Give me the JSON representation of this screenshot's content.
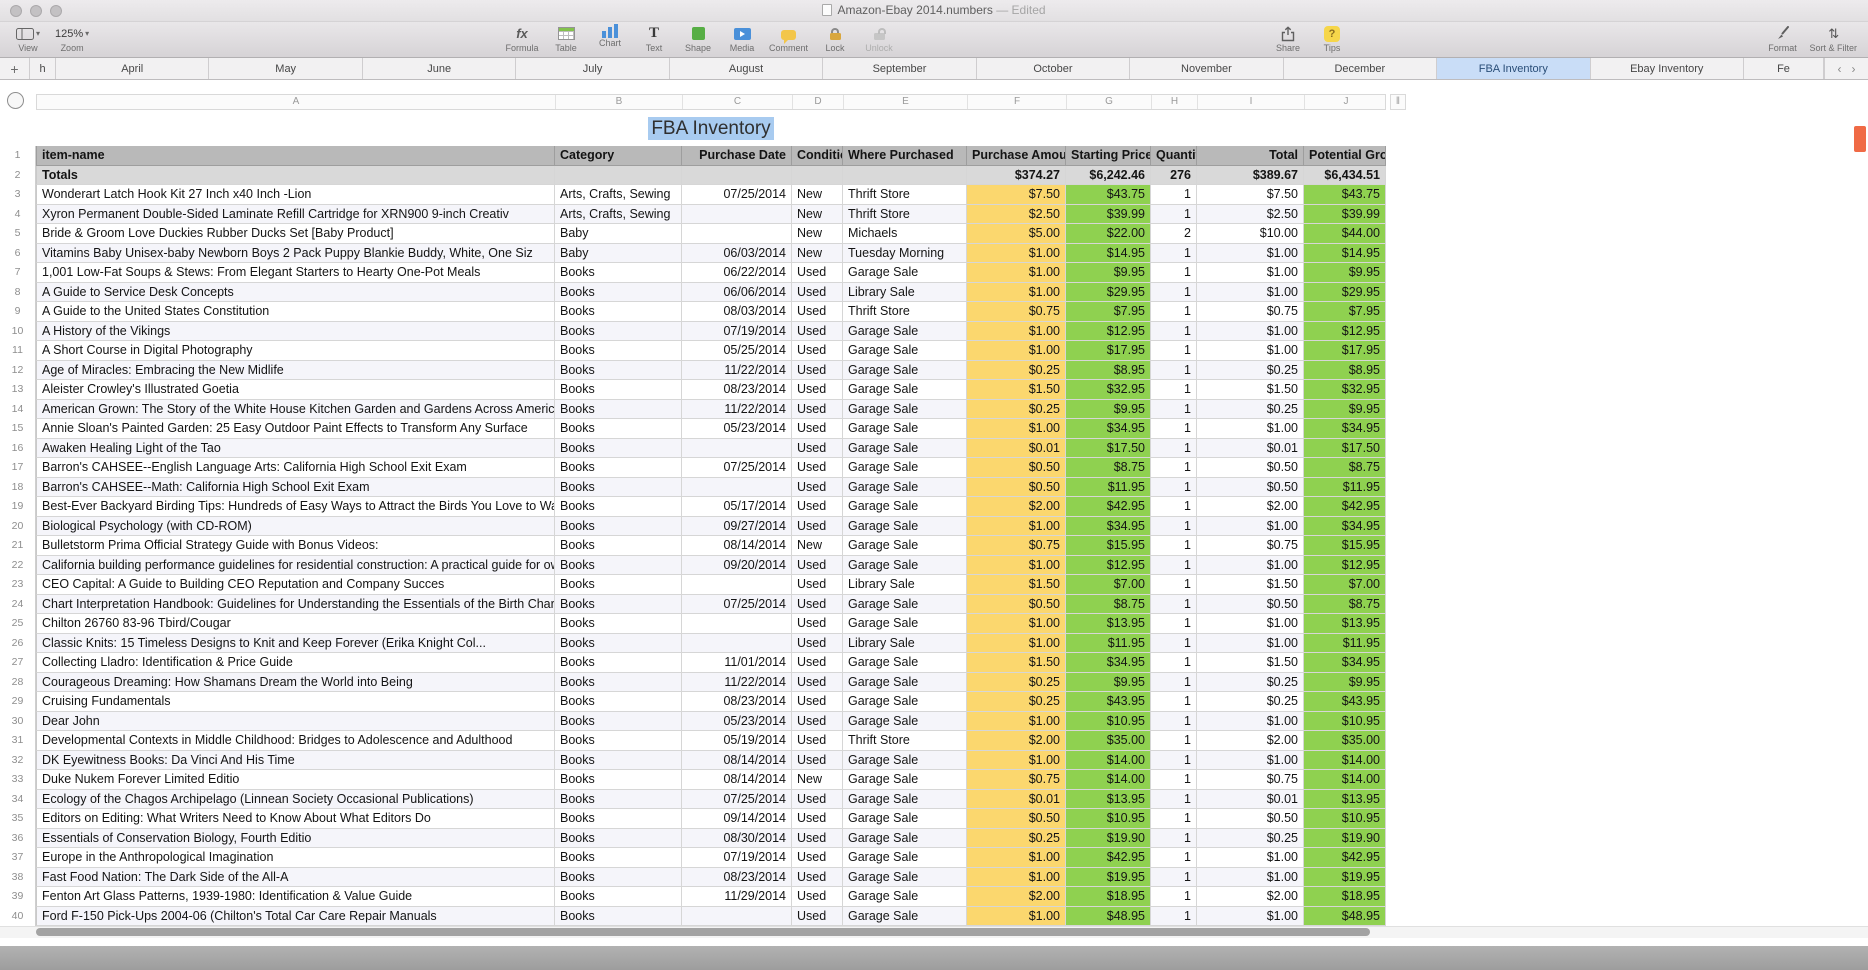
{
  "window": {
    "title": "Amazon-Ebay 2014.numbers",
    "edited_suffix": "— Edited"
  },
  "toolbar": {
    "view": {
      "label": "View"
    },
    "zoom": {
      "label": "Zoom",
      "value": "125%",
      "chevron": "▾"
    },
    "formula": {
      "label": "Formula",
      "glyph": "fx"
    },
    "table": {
      "label": "Table"
    },
    "chart": {
      "label": "Chart"
    },
    "text": {
      "label": "Text",
      "glyph": "T"
    },
    "shape": {
      "label": "Shape"
    },
    "media": {
      "label": "Media"
    },
    "comment": {
      "label": "Comment"
    },
    "lock": {
      "label": "Lock"
    },
    "unlock": {
      "label": "Unlock"
    },
    "share": {
      "label": "Share"
    },
    "tips": {
      "label": "Tips",
      "glyph": "?"
    },
    "format": {
      "label": "Format"
    },
    "sort_filter": {
      "label": "Sort & Filter",
      "glyph": "⇅"
    }
  },
  "tabbar": {
    "add_button": "+",
    "prev_arrow": "‹",
    "next_arrow": "›",
    "active": "FBA Inventory",
    "tabs": [
      {
        "label": "h",
        "cut": "left"
      },
      {
        "label": "April"
      },
      {
        "label": "May"
      },
      {
        "label": "June"
      },
      {
        "label": "July"
      },
      {
        "label": "August"
      },
      {
        "label": "September"
      },
      {
        "label": "October"
      },
      {
        "label": "November"
      },
      {
        "label": "December"
      },
      {
        "label": "FBA Inventory",
        "active": true
      },
      {
        "label": "Ebay Inventory"
      },
      {
        "label": "Fe",
        "cut": "right"
      }
    ]
  },
  "grid": {
    "column_letters": [
      "A",
      "B",
      "C",
      "D",
      "E",
      "F",
      "G",
      "H",
      "I",
      "J"
    ],
    "add_column_glyph": "‖"
  },
  "colors": {
    "amount_column": "#FBD76E",
    "price_columns": "#8FD150",
    "header_row": "#B9B9B9",
    "active_tab": "#C9DDF7",
    "title_selection": "#A8CBF0",
    "scroll_marker": "#F06A45"
  },
  "sheet": {
    "title": "FBA Inventory",
    "headers": [
      "item-name",
      "Category",
      "Purchase Date",
      "Condition",
      "Where Purchased",
      "Purchase Amount",
      "Starting Price",
      "Quantity",
      "Total",
      "Potential Gross"
    ],
    "totals": {
      "num": "2",
      "label": "Totals",
      "amount": "$374.27",
      "price": "$6,242.46",
      "qty": "276",
      "total": "$389.67",
      "gross": "$6,434.51"
    },
    "rows": [
      {
        "num": 3,
        "name": "Wonderart Latch Hook Kit 27 Inch x40 Inch -Lion",
        "category": "Arts, Crafts, Sewing",
        "date": "07/25/2014",
        "condition": "New",
        "where": "Thrift Store",
        "amount": "$7.50",
        "price": "$43.75",
        "qty": "1",
        "total": "$7.50",
        "gross": "$43.75"
      },
      {
        "num": 4,
        "name": "Xyron Permanent Double-Sided Laminate Refill Cartridge for XRN900 9-inch Creativ",
        "category": "Arts, Crafts, Sewing",
        "date": "",
        "condition": "New",
        "where": "Thrift Store",
        "amount": "$2.50",
        "price": "$39.99",
        "qty": "1",
        "total": "$2.50",
        "gross": "$39.99"
      },
      {
        "num": 5,
        "name": "Bride & Groom Love Duckies Rubber Ducks Set [Baby Product]",
        "category": "Baby",
        "date": "",
        "condition": "New",
        "where": "Michaels",
        "amount": "$5.00",
        "price": "$22.00",
        "qty": "2",
        "total": "$10.00",
        "gross": "$44.00"
      },
      {
        "num": 6,
        "name": "Vitamins Baby Unisex-baby Newborn Boys 2 Pack Puppy Blankie Buddy, White, One Siz",
        "category": "Baby",
        "date": "06/03/2014",
        "condition": "New",
        "where": "Tuesday Morning",
        "amount": "$1.00",
        "price": "$14.95",
        "qty": "1",
        "total": "$1.00",
        "gross": "$14.95"
      },
      {
        "num": 7,
        "name": "1,001 Low-Fat Soups & Stews: From Elegant Starters to Hearty One-Pot Meals",
        "category": "Books",
        "date": "06/22/2014",
        "condition": "Used",
        "where": "Garage Sale",
        "amount": "$1.00",
        "price": "$9.95",
        "qty": "1",
        "total": "$1.00",
        "gross": "$9.95"
      },
      {
        "num": 8,
        "name": "A Guide to Service Desk Concepts",
        "category": "Books",
        "date": "06/06/2014",
        "condition": "Used",
        "where": "Library Sale",
        "amount": "$1.00",
        "price": "$29.95",
        "qty": "1",
        "total": "$1.00",
        "gross": "$29.95"
      },
      {
        "num": 9,
        "name": "A Guide to the United States Constitution",
        "category": "Books",
        "date": "08/03/2014",
        "condition": "Used",
        "where": "Thrift Store",
        "amount": "$0.75",
        "price": "$7.95",
        "qty": "1",
        "total": "$0.75",
        "gross": "$7.95"
      },
      {
        "num": 10,
        "name": "A History of the Vikings",
        "category": "Books",
        "date": "07/19/2014",
        "condition": "Used",
        "where": "Garage Sale",
        "amount": "$1.00",
        "price": "$12.95",
        "qty": "1",
        "total": "$1.00",
        "gross": "$12.95"
      },
      {
        "num": 11,
        "name": "A Short Course in Digital Photography",
        "category": "Books",
        "date": "05/25/2014",
        "condition": "Used",
        "where": "Garage Sale",
        "amount": "$1.00",
        "price": "$17.95",
        "qty": "1",
        "total": "$1.00",
        "gross": "$17.95"
      },
      {
        "num": 12,
        "name": "Age of Miracles: Embracing the New Midlife",
        "category": "Books",
        "date": "11/22/2014",
        "condition": "Used",
        "where": "Garage Sale",
        "amount": "$0.25",
        "price": "$8.95",
        "qty": "1",
        "total": "$0.25",
        "gross": "$8.95"
      },
      {
        "num": 13,
        "name": "Aleister Crowley's Illustrated Goetia",
        "category": "Books",
        "date": "08/23/2014",
        "condition": "Used",
        "where": "Garage Sale",
        "amount": "$1.50",
        "price": "$32.95",
        "qty": "1",
        "total": "$1.50",
        "gross": "$32.95"
      },
      {
        "num": 14,
        "name": "American Grown: The Story of the White House Kitchen Garden and Gardens Across America",
        "category": "Books",
        "date": "11/22/2014",
        "condition": "Used",
        "where": "Garage Sale",
        "amount": "$0.25",
        "price": "$9.95",
        "qty": "1",
        "total": "$0.25",
        "gross": "$9.95"
      },
      {
        "num": 15,
        "name": "Annie Sloan's Painted Garden: 25 Easy Outdoor Paint Effects to Transform Any Surface",
        "category": "Books",
        "date": "05/23/2014",
        "condition": "Used",
        "where": "Garage Sale",
        "amount": "$1.00",
        "price": "$34.95",
        "qty": "1",
        "total": "$1.00",
        "gross": "$34.95"
      },
      {
        "num": 16,
        "name": "Awaken Healing Light of the Tao",
        "category": "Books",
        "date": "",
        "condition": "Used",
        "where": "Garage Sale",
        "amount": "$0.01",
        "price": "$17.50",
        "qty": "1",
        "total": "$0.01",
        "gross": "$17.50"
      },
      {
        "num": 17,
        "name": "Barron's CAHSEE--English Language Arts: California High School Exit Exam",
        "category": "Books",
        "date": "07/25/2014",
        "condition": "Used",
        "where": "Garage Sale",
        "amount": "$0.50",
        "price": "$8.75",
        "qty": "1",
        "total": "$0.50",
        "gross": "$8.75"
      },
      {
        "num": 18,
        "name": "Barron's CAHSEE--Math: California High School Exit Exam",
        "category": "Books",
        "date": "",
        "condition": "Used",
        "where": "Garage Sale",
        "amount": "$0.50",
        "price": "$11.95",
        "qty": "1",
        "total": "$0.50",
        "gross": "$11.95"
      },
      {
        "num": 19,
        "name": "Best-Ever Backyard Birding Tips: Hundreds of Easy Ways to Attract the Birds You Love to Watch",
        "category": "Books",
        "date": "05/17/2014",
        "condition": "Used",
        "where": "Garage Sale",
        "amount": "$2.00",
        "price": "$42.95",
        "qty": "1",
        "total": "$2.00",
        "gross": "$42.95"
      },
      {
        "num": 20,
        "name": "Biological Psychology (with CD-ROM)",
        "category": "Books",
        "date": "09/27/2014",
        "condition": "Used",
        "where": "Garage Sale",
        "amount": "$1.00",
        "price": "$34.95",
        "qty": "1",
        "total": "$1.00",
        "gross": "$34.95"
      },
      {
        "num": 21,
        "name": "Bulletstorm Prima Official Strategy Guide with Bonus Videos:",
        "category": "Books",
        "date": "08/14/2014",
        "condition": "New",
        "where": "Garage Sale",
        "amount": "$0.75",
        "price": "$15.95",
        "qty": "1",
        "total": "$0.75",
        "gross": "$15.95"
      },
      {
        "num": 22,
        "name": "California building performance guidelines for residential construction: A practical guide for owners of new homes : constr",
        "category": "Books",
        "date": "09/20/2014",
        "condition": "Used",
        "where": "Garage Sale",
        "amount": "$1.00",
        "price": "$12.95",
        "qty": "1",
        "total": "$1.00",
        "gross": "$12.95"
      },
      {
        "num": 23,
        "name": "CEO Capital: A Guide to Building CEO Reputation and Company Succes",
        "category": "Books",
        "date": "",
        "condition": "Used",
        "where": "Library Sale",
        "amount": "$1.50",
        "price": "$7.00",
        "qty": "1",
        "total": "$1.50",
        "gross": "$7.00"
      },
      {
        "num": 24,
        "name": "Chart Interpretation Handbook: Guidelines for Understanding the Essentials of the Birth Chart",
        "category": "Books",
        "date": "07/25/2014",
        "condition": "Used",
        "where": "Garage Sale",
        "amount": "$0.50",
        "price": "$8.75",
        "qty": "1",
        "total": "$0.50",
        "gross": "$8.75"
      },
      {
        "num": 25,
        "name": "Chilton 26760 83-96 Tbird/Cougar",
        "category": "Books",
        "date": "",
        "condition": "Used",
        "where": "Garage Sale",
        "amount": "$1.00",
        "price": "$13.95",
        "qty": "1",
        "total": "$1.00",
        "gross": "$13.95"
      },
      {
        "num": 26,
        "name": "Classic Knits: 15 Timeless Designs to Knit and Keep Forever (Erika Knight Col...",
        "category": "Books",
        "date": "",
        "condition": "Used",
        "where": "Library Sale",
        "amount": "$1.00",
        "price": "$11.95",
        "qty": "1",
        "total": "$1.00",
        "gross": "$11.95"
      },
      {
        "num": 27,
        "name": "Collecting Lladro: Identification & Price Guide",
        "category": "Books",
        "date": "11/01/2014",
        "condition": "Used",
        "where": "Garage Sale",
        "amount": "$1.50",
        "price": "$34.95",
        "qty": "1",
        "total": "$1.50",
        "gross": "$34.95"
      },
      {
        "num": 28,
        "name": "Courageous Dreaming: How Shamans Dream the World into Being",
        "category": "Books",
        "date": "11/22/2014",
        "condition": "Used",
        "where": "Garage Sale",
        "amount": "$0.25",
        "price": "$9.95",
        "qty": "1",
        "total": "$0.25",
        "gross": "$9.95"
      },
      {
        "num": 29,
        "name": "Cruising Fundamentals",
        "category": "Books",
        "date": "08/23/2014",
        "condition": "Used",
        "where": "Garage Sale",
        "amount": "$0.25",
        "price": "$43.95",
        "qty": "1",
        "total": "$0.25",
        "gross": "$43.95"
      },
      {
        "num": 30,
        "name": "Dear John",
        "category": "Books",
        "date": "05/23/2014",
        "condition": "Used",
        "where": "Garage Sale",
        "amount": "$1.00",
        "price": "$10.95",
        "qty": "1",
        "total": "$1.00",
        "gross": "$10.95"
      },
      {
        "num": 31,
        "name": "Developmental Contexts in Middle Childhood: Bridges to Adolescence and Adulthood",
        "category": "Books",
        "date": "05/19/2014",
        "condition": "Used",
        "where": "Thrift Store",
        "amount": "$2.00",
        "price": "$35.00",
        "qty": "1",
        "total": "$2.00",
        "gross": "$35.00"
      },
      {
        "num": 32,
        "name": "DK Eyewitness Books: Da Vinci And His Time",
        "category": "Books",
        "date": "08/14/2014",
        "condition": "Used",
        "where": "Garage Sale",
        "amount": "$1.00",
        "price": "$14.00",
        "qty": "1",
        "total": "$1.00",
        "gross": "$14.00"
      },
      {
        "num": 33,
        "name": "Duke Nukem Forever Limited Editio",
        "category": "Books",
        "date": "08/14/2014",
        "condition": "New",
        "where": "Garage Sale",
        "amount": "$0.75",
        "price": "$14.00",
        "qty": "1",
        "total": "$0.75",
        "gross": "$14.00"
      },
      {
        "num": 34,
        "name": "Ecology of the Chagos Archipelago (Linnean Society Occasional Publications)",
        "category": "Books",
        "date": "07/25/2014",
        "condition": "Used",
        "where": "Garage Sale",
        "amount": "$0.01",
        "price": "$13.95",
        "qty": "1",
        "total": "$0.01",
        "gross": "$13.95"
      },
      {
        "num": 35,
        "name": "Editors on Editing: What Writers Need to Know About What Editors Do",
        "category": "Books",
        "date": "09/14/2014",
        "condition": "Used",
        "where": "Garage Sale",
        "amount": "$0.50",
        "price": "$10.95",
        "qty": "1",
        "total": "$0.50",
        "gross": "$10.95"
      },
      {
        "num": 36,
        "name": "Essentials of Conservation Biology, Fourth Editio",
        "category": "Books",
        "date": "08/30/2014",
        "condition": "Used",
        "where": "Garage Sale",
        "amount": "$0.25",
        "price": "$19.90",
        "qty": "1",
        "total": "$0.25",
        "gross": "$19.90"
      },
      {
        "num": 37,
        "name": "Europe in the Anthropological Imagination",
        "category": "Books",
        "date": "07/19/2014",
        "condition": "Used",
        "where": "Garage Sale",
        "amount": "$1.00",
        "price": "$42.95",
        "qty": "1",
        "total": "$1.00",
        "gross": "$42.95"
      },
      {
        "num": 38,
        "name": "Fast Food Nation: The Dark Side of the All-A",
        "category": "Books",
        "date": "08/23/2014",
        "condition": "Used",
        "where": "Garage Sale",
        "amount": "$1.00",
        "price": "$19.95",
        "qty": "1",
        "total": "$1.00",
        "gross": "$19.95"
      },
      {
        "num": 39,
        "name": "Fenton Art Glass Patterns, 1939-1980: Identification & Value Guide",
        "category": "Books",
        "date": "11/29/2014",
        "condition": "Used",
        "where": "Garage Sale",
        "amount": "$2.00",
        "price": "$18.95",
        "qty": "1",
        "total": "$2.00",
        "gross": "$18.95"
      },
      {
        "num": 40,
        "name": "Ford F-150 Pick-Ups 2004-06 (Chilton's Total Car Care Repair Manuals",
        "category": "Books",
        "date": "",
        "condition": "Used",
        "where": "Garage Sale",
        "amount": "$1.00",
        "price": "$48.95",
        "qty": "1",
        "total": "$1.00",
        "gross": "$48.95"
      }
    ]
  }
}
